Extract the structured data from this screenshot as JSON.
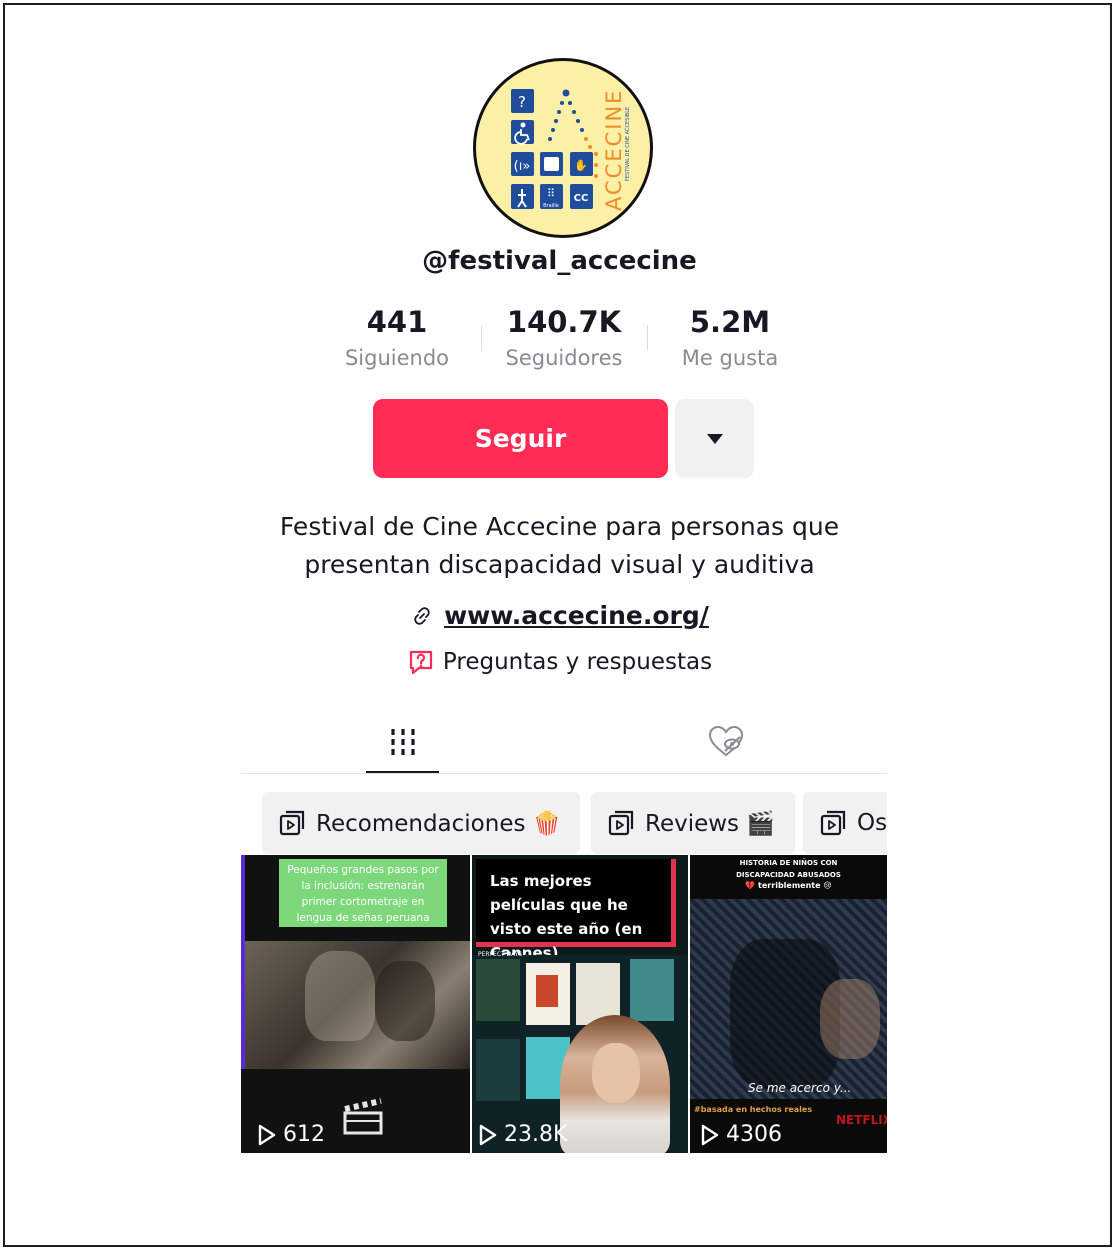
{
  "profile": {
    "handle": "@festival_accecine",
    "avatar_icon": "accecine-logo",
    "avatar_logo_text": "ACCECINE",
    "avatar_logo_subtitle": "FESTIVAL DE CINE ACCESIBLE",
    "avatar_braille_label": "Braille",
    "avatar_cc_label": "CC"
  },
  "stats": [
    {
      "value": "441",
      "label": "Siguiendo"
    },
    {
      "value": "140.7K",
      "label": "Seguidores"
    },
    {
      "value": "5.2M",
      "label": "Me gusta"
    }
  ],
  "actions": {
    "follow_label": "Seguir",
    "more_icon": "caret-down-icon"
  },
  "bio": {
    "line1": "Festival de Cine Accecine para personas que",
    "line2": "presentan discapacidad visual y auditiva"
  },
  "link": {
    "icon": "link-icon",
    "text": "www.accecine.org/"
  },
  "qa": {
    "icon": "question-icon",
    "text": "Preguntas y respuestas"
  },
  "tabs": [
    {
      "icon": "grid-icon",
      "active": true
    },
    {
      "icon": "liked-hidden-icon",
      "active": false
    }
  ],
  "playlists": [
    {
      "icon": "playlist-icon",
      "label": "Recomendaciones 🍿"
    },
    {
      "icon": "playlist-icon",
      "label": "Reviews 🎬"
    },
    {
      "icon": "playlist-icon",
      "label": "Os"
    }
  ],
  "videos": [
    {
      "caption": "Pequeños grandes pasos por la inclusión: estrenarán primer cortometraje en lengua de señas peruana",
      "views": "612"
    },
    {
      "caption": "Las mejores películas que he visto este año (en Cannes)",
      "views": "23.8K",
      "poster_label": "PERFECT DAYS"
    },
    {
      "caption": "HISTORIA DE NIÑOS CON DISCAPACIDAD ABUSADOS",
      "caption_sub": "💔 terriblemente 😢",
      "subtitle": "Se me acerco y...",
      "tag": "#basada en hechos reales",
      "brand": "NETFLIX",
      "views": "4306"
    }
  ],
  "colors": {
    "accent": "#fe2c55",
    "avatar_bg": "#fbf0a6",
    "logo_blue": "#1f4d9c",
    "logo_orange": "#f28c28"
  }
}
